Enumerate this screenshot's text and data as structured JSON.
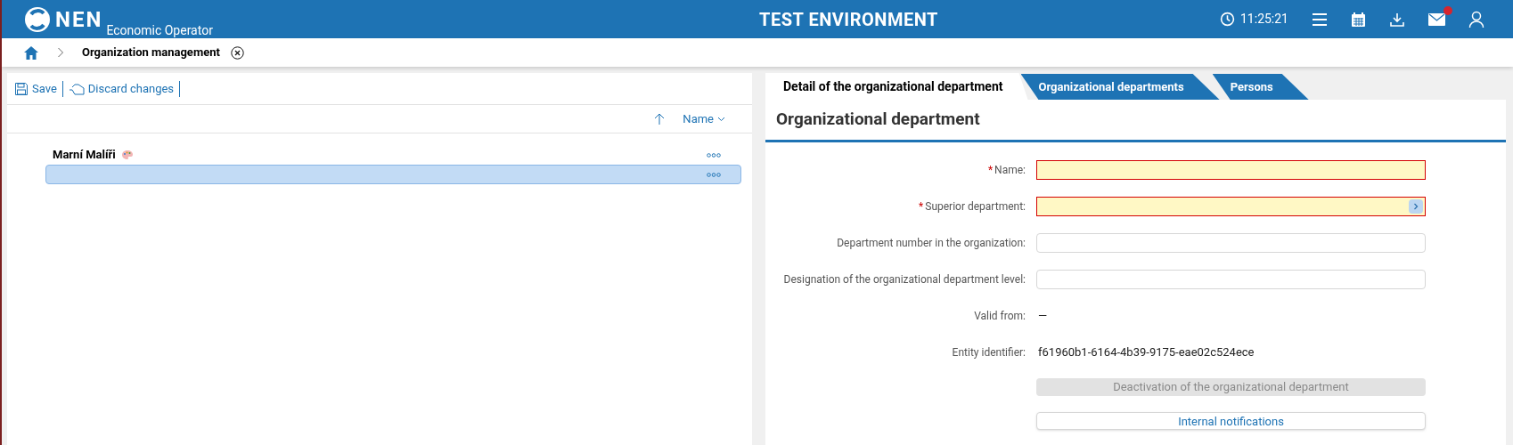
{
  "header": {
    "logo": "NEN",
    "subtitle": "Economic Operator",
    "environment": "TEST ENVIRONMENT",
    "time": "11:25:21",
    "mail_unread": true
  },
  "breadcrumb": {
    "title": "Organization management"
  },
  "toolbar": [
    "Save",
    "Discard changes"
  ],
  "list": {
    "sort_column": "Name",
    "rows": [
      {
        "label": "Marní Malíři",
        "selected": false
      },
      {
        "selected": true
      }
    ]
  },
  "tabs": [
    {
      "label": "Detail of the organizational department",
      "selected": true
    },
    {
      "label": "Organizational departments",
      "selected": false
    },
    {
      "label": "Persons",
      "selected": false
    }
  ],
  "section_title": "Organizational department",
  "form": [
    {
      "kind": "input",
      "label": "Name:",
      "required_mark": "*",
      "invalid": true
    },
    {
      "kind": "picker",
      "label": "Superior department:",
      "required_mark": "*",
      "invalid": true
    },
    {
      "kind": "input",
      "label": "Department number in the organization:",
      "invalid": false
    },
    {
      "kind": "input",
      "label": "Designation of the organizational department level:",
      "invalid": false
    },
    {
      "kind": "text",
      "label": "Valid from:",
      "value": "—"
    },
    {
      "kind": "text",
      "label": "Entity identifier:",
      "value": "f61960b1-6164-4b39-9175-eae02c524ece"
    }
  ],
  "buttons": [
    {
      "label": "Deactivation of the organizational department",
      "disabled": true
    },
    {
      "label": "Internal notifications",
      "disabled": false
    }
  ]
}
